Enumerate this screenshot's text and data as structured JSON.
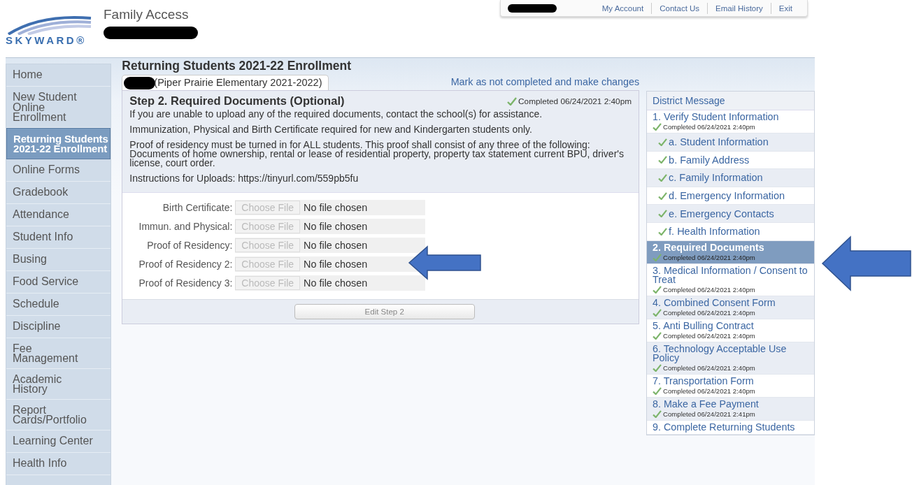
{
  "header": {
    "logo_text": "SKYWARD®",
    "app_title": "Family Access",
    "top_links": [
      "My Account",
      "Contact Us",
      "Email History",
      "Exit"
    ]
  },
  "sidebar": {
    "items": [
      {
        "label": "Home",
        "selected": false
      },
      {
        "label": "New Student Online Enrollment",
        "selected": false
      },
      {
        "label": "Returning Students 2021-22 Enrollment",
        "selected": true
      },
      {
        "label": "Online Forms",
        "selected": false
      },
      {
        "label": "Gradebook",
        "selected": false
      },
      {
        "label": "Attendance",
        "selected": false
      },
      {
        "label": "Student Info",
        "selected": false
      },
      {
        "label": "Busing",
        "selected": false
      },
      {
        "label": "Food Service",
        "selected": false
      },
      {
        "label": "Schedule",
        "selected": false
      },
      {
        "label": "Discipline",
        "selected": false
      },
      {
        "label": "Fee Management",
        "selected": false
      },
      {
        "label": "Academic History",
        "selected": false
      },
      {
        "label": "Report Cards/Portfolio",
        "selected": false
      },
      {
        "label": "Learning Center",
        "selected": false
      },
      {
        "label": "Health Info",
        "selected": false
      }
    ]
  },
  "page_title": "Returning Students 2021-22 Enrollment",
  "student_tab": {
    "label": "(Piper Prairie Elementary 2021-2022)",
    "selected": true
  },
  "mark_link": "Mark as not completed and make changes",
  "step": {
    "title": "Step 2. Required Documents (Optional)",
    "completed": "Completed 06/24/2021 2:40pm",
    "paragraphs": [
      "If you are unable to upload any of the required documents, contact the school(s) for assistance.",
      "Immunization, Physical and Birth Certificate required for new and Kindergarten students only.",
      "Proof of residency must be turned in for ALL students. This proof shall consist of any three of the following: Documents of home ownership, rental or lease of residential property, property tax statement current BPU, driver's license, court order.",
      "Instructions for Uploads: https://tinyurl.com/559pb5fu"
    ],
    "uploads": [
      {
        "label": "Birth Certificate:",
        "button": "Choose File",
        "status": "No file chosen"
      },
      {
        "label": "Immun. and Physical:",
        "button": "Choose File",
        "status": "No file chosen"
      },
      {
        "label": "Proof of Residency:",
        "button": "Choose File",
        "status": "No file chosen"
      },
      {
        "label": "Proof of Residency 2:",
        "button": "Choose File",
        "status": "No file chosen"
      },
      {
        "label": "Proof of Residency 3:",
        "button": "Choose File",
        "status": "No file chosen"
      }
    ],
    "edit_button": "Edit Step 2"
  },
  "steps_panel": {
    "header": "District Message",
    "steps": [
      {
        "label": "1. Verify Student Information",
        "completed": "Completed 06/24/2021 2:40pm",
        "selected": false,
        "children": [
          {
            "label": "a. Student Information"
          },
          {
            "label": "b. Family Address"
          },
          {
            "label": "c. Family Information"
          },
          {
            "label": "d. Emergency Information"
          },
          {
            "label": "e. Emergency Contacts"
          },
          {
            "label": "f. Health Information"
          }
        ]
      },
      {
        "label": "2. Required Documents",
        "completed": "Completed 06/24/2021 2:40pm",
        "selected": true
      },
      {
        "label": "3. Medical Information / Consent to Treat",
        "completed": "Completed 06/24/2021 2:40pm",
        "selected": false
      },
      {
        "label": "4. Combined Consent Form",
        "completed": "Completed 06/24/2021 2:40pm",
        "selected": false
      },
      {
        "label": "5. Anti Bulling Contract",
        "completed": "Completed 06/24/2021 2:40pm",
        "selected": false
      },
      {
        "label": "6. Technology Acceptable Use Policy",
        "completed": "Completed 06/24/2021 2:40pm",
        "selected": false
      },
      {
        "label": "7. Transportation Form",
        "completed": "Completed 06/24/2021 2:40pm",
        "selected": false
      },
      {
        "label": "8. Make a Fee Payment",
        "completed": "Completed 06/24/2021 2:41pm",
        "selected": false
      },
      {
        "label": "9. Complete Returning Students",
        "selected": false
      }
    ]
  }
}
